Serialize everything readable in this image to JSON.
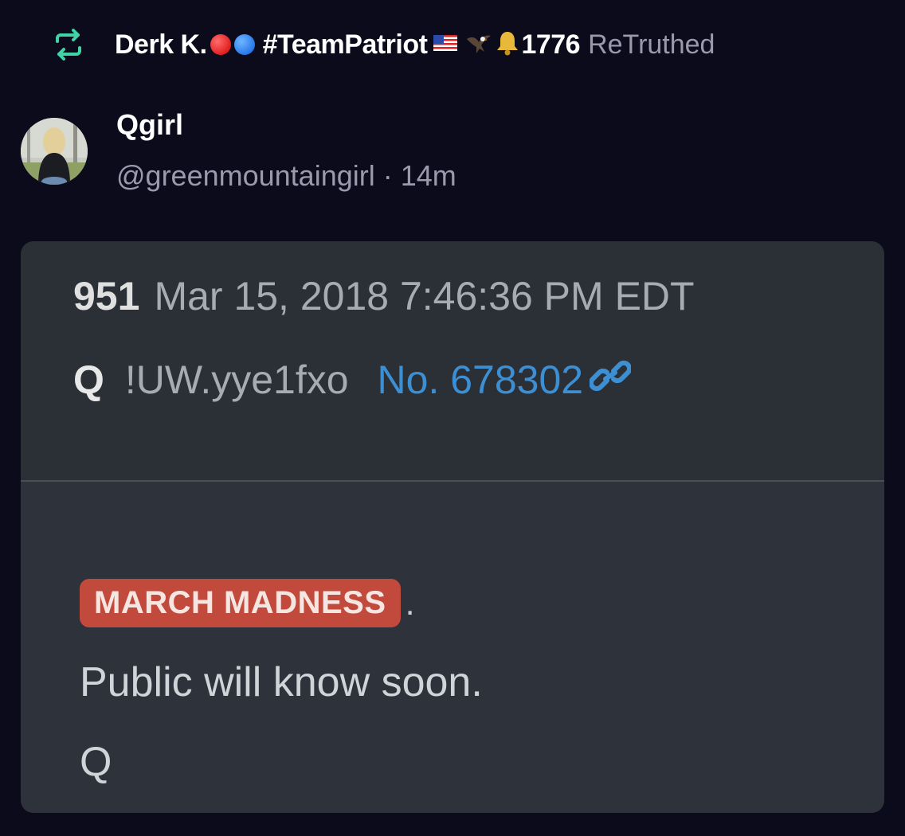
{
  "retruth": {
    "name": "Derk K.",
    "hashtag": "#TeamPatriot",
    "number": "1776",
    "suffix": "ReTruthed",
    "accent_color": "#3fd3a6"
  },
  "author": {
    "display_name": "Qgirl",
    "meta": "@greenmountaingirl · 14m"
  },
  "post": {
    "number": "951",
    "timestamp": "Mar 15, 2018 7:46:36 PM EDT",
    "author": "Q",
    "tripcode": "!UW.yye1fxo",
    "post_no": "No. 678302",
    "tag": "MARCH MADNESS",
    "tag_punct": ".",
    "line1": "Public will know soon.",
    "signature": "Q",
    "tag_color": "#c24a3c",
    "link_color": "#3d8fd4"
  }
}
